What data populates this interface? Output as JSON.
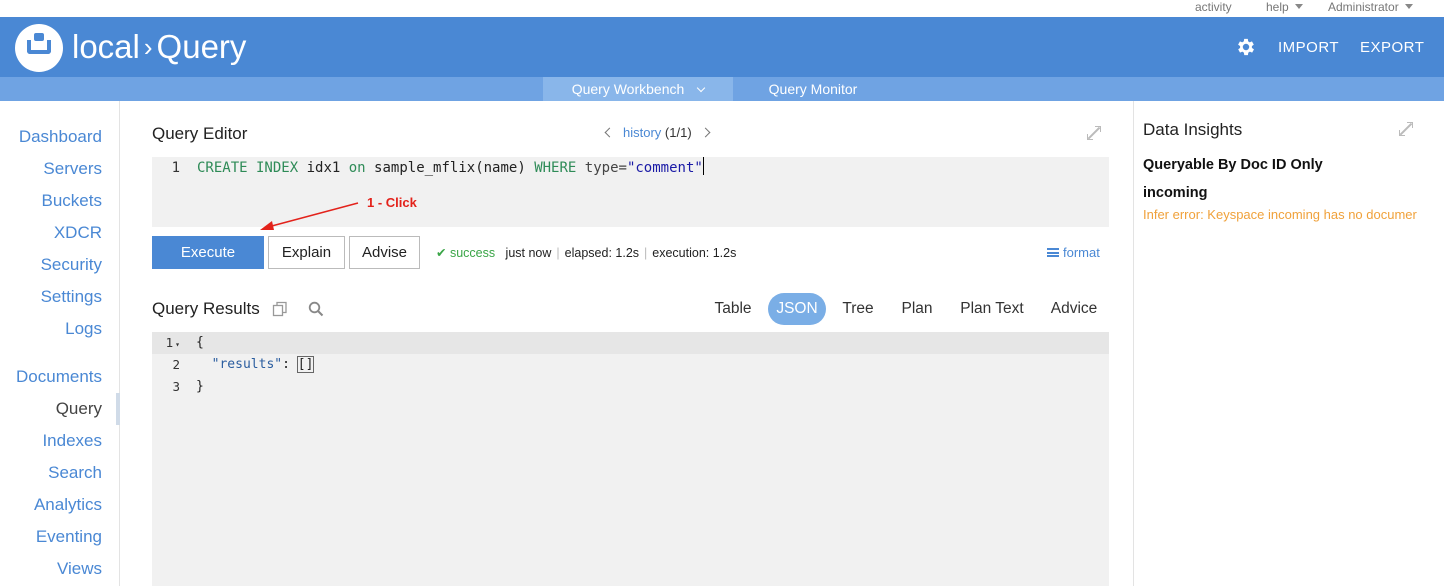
{
  "topbar": {
    "activity": "activity",
    "help": "help",
    "user": "Administrator"
  },
  "header": {
    "cluster": "local",
    "separator": "›",
    "page": "Query",
    "import": "IMPORT",
    "export": "EXPORT"
  },
  "subnav": {
    "workbench": "Query Workbench",
    "monitor": "Query Monitor"
  },
  "sidebar": {
    "items": [
      "Dashboard",
      "Servers",
      "Buckets",
      "XDCR",
      "Security",
      "Settings",
      "Logs",
      "Documents",
      "Query",
      "Indexes",
      "Search",
      "Analytics",
      "Eventing",
      "Views"
    ],
    "current": "Query"
  },
  "editor": {
    "title": "Query Editor",
    "history_link": "history",
    "history_count": "(1/1)",
    "line_number": "1",
    "code": {
      "kw1": "CREATE INDEX",
      "id1": "idx1",
      "kw2": "on",
      "id2": "sample_mflix(name)",
      "kw3": "WHERE",
      "id3": "type=",
      "str": "\"comment\""
    }
  },
  "annotation": {
    "text": "1 - Click"
  },
  "actions": {
    "execute": "Execute",
    "explain": "Explain",
    "advise": "Advise",
    "format": "format"
  },
  "status": {
    "result": "success",
    "when": "just now",
    "elapsed": "elapsed: 1.2s",
    "execution": "execution: 1.2s"
  },
  "results": {
    "title": "Query Results",
    "tabs": [
      "Table",
      "JSON",
      "Tree",
      "Plan",
      "Plan Text",
      "Advice"
    ],
    "active_tab": "JSON",
    "lines": [
      {
        "n": "1",
        "text": "{"
      },
      {
        "n": "2",
        "key": "\"results\"",
        "rest": ": ",
        "bracket": "[]"
      },
      {
        "n": "3",
        "text": "}"
      }
    ]
  },
  "insights": {
    "title": "Data Insights",
    "line1": "Queryable By Doc ID Only",
    "line2": "incoming",
    "error": "Infer error: Keyspace incoming has no documer"
  },
  "colors": {
    "brand": "#4a88d4",
    "success": "#3aa547",
    "warning": "#f0a13a",
    "annotation": "#e3221b"
  }
}
